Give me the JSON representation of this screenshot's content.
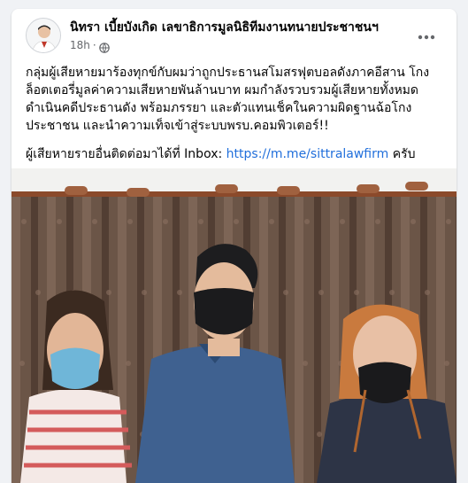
{
  "post": {
    "author": "นิทรา เบี้ยบังเกิด เลขาธิการมูลนิธิทีมงานทนายประชาชนฯ",
    "timestamp": "18h",
    "separator": "·",
    "privacy_icon": "globe-icon",
    "more_icon": "more-options-icon",
    "paragraph_1": "กลุ่มผู้เสียหายมาร้องทุกข์กับผมว่าถูกประธานสโมสรฟุตบอลดังภาคอีสาน โกงล็อตเตอรี่มูลค่าความเสียหายพันล้านบาท  ผมกำลังรวบรวมผู้เสียหายทั้งหมด ดำเนินคดีประธานดัง พร้อมภรรยา และตัวแทนเช็คในความผิดฐานฉ้อโกงประชาชน และนำความเท็จเข้าสู่ระบบพรบ.คอมพิวเตอร์!!",
    "paragraph_2_prefix": "ผู้เสียหายรายอื่นติดต่อมาได้ที่ Inbox: ",
    "paragraph_2_link": "https://m.me/sittralawfirm",
    "paragraph_2_suffix": " ครับ"
  },
  "colors": {
    "link": "#216fdb",
    "secondary_text": "#65676b",
    "curtain": "#6b5547"
  }
}
